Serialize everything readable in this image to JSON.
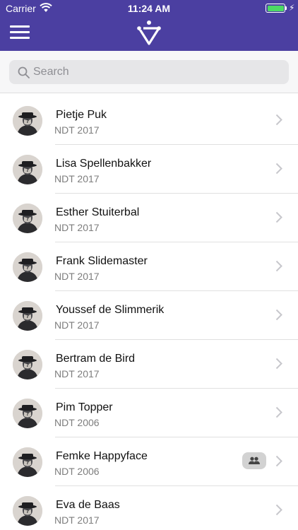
{
  "status_bar": {
    "carrier": "Carrier",
    "time": "11:24 AM",
    "battery_percent": 100,
    "battery_color": "#4cd964"
  },
  "header": {
    "background_color": "#4b3fa1",
    "menu_icon": "hamburger-menu-icon",
    "logo_icon": "triangle-logo-icon"
  },
  "search": {
    "placeholder": "Search",
    "value": "",
    "icon": "search-icon"
  },
  "contacts": [
    {
      "name": "Pietje Puk",
      "group": "NDT 2017",
      "badge": false
    },
    {
      "name": "Lisa Spellenbakker",
      "group": "NDT 2017",
      "badge": false
    },
    {
      "name": "Esther Stuiterbal",
      "group": "NDT 2017",
      "badge": false
    },
    {
      "name": "Frank Slidemaster",
      "group": "NDT 2017",
      "badge": false
    },
    {
      "name": "Youssef de Slimmerik",
      "group": "NDT 2017",
      "badge": false
    },
    {
      "name": "Bertram de Bird",
      "group": "NDT 2017",
      "badge": false
    },
    {
      "name": "Pim Topper",
      "group": "NDT 2006",
      "badge": false
    },
    {
      "name": "Femke Happyface",
      "group": "NDT 2006",
      "badge": true,
      "badge_icon": "group-people-icon"
    },
    {
      "name": "Eva de Baas",
      "group": "NDT 2017",
      "badge": false
    }
  ]
}
